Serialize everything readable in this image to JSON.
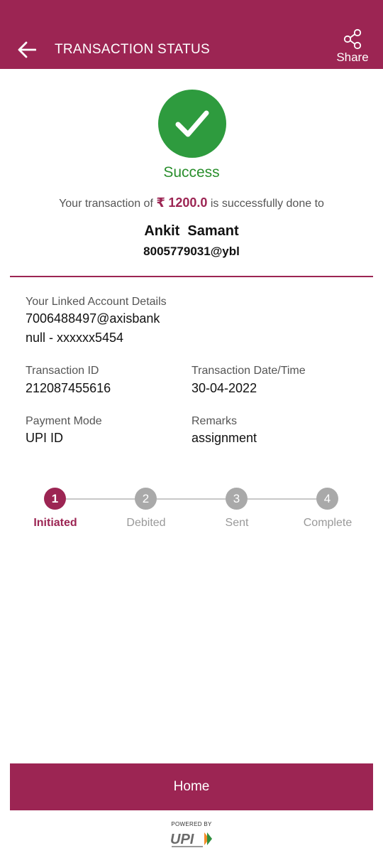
{
  "header": {
    "title": "TRANSACTION STATUS",
    "share_label": "Share"
  },
  "status": {
    "text": "Success",
    "summary_prefix": "Your transaction of ",
    "currency_symbol": "₹",
    "amount": "1200.0",
    "summary_suffix": " is successfully done to",
    "payee_name": "Ankit  Samant",
    "payee_vpa": "8005779031@ybl"
  },
  "details": {
    "linked_account_label": "Your Linked Account Details",
    "linked_account_vpa": "7006488497@axisbank",
    "linked_account_number": "null - xxxxxx5454",
    "transaction_id_label": "Transaction ID",
    "transaction_id": "212087455616",
    "date_label": "Transaction Date/Time",
    "date": "30-04-2022",
    "payment_mode_label": "Payment Mode",
    "payment_mode": "UPI ID",
    "remarks_label": "Remarks",
    "remarks": "assignment"
  },
  "steps": [
    {
      "number": "1",
      "label": "Initiated",
      "state": "active"
    },
    {
      "number": "2",
      "label": "Debited",
      "state": "inactive"
    },
    {
      "number": "3",
      "label": "Sent",
      "state": "inactive"
    },
    {
      "number": "4",
      "label": "Complete",
      "state": "inactive"
    }
  ],
  "footer": {
    "home_label": "Home",
    "powered_by": "POWERED BY",
    "logo_text": "UPI"
  },
  "colors": {
    "brand": "#9c2553",
    "success": "#2e9b3e",
    "inactive_step": "#a9a9a9"
  }
}
